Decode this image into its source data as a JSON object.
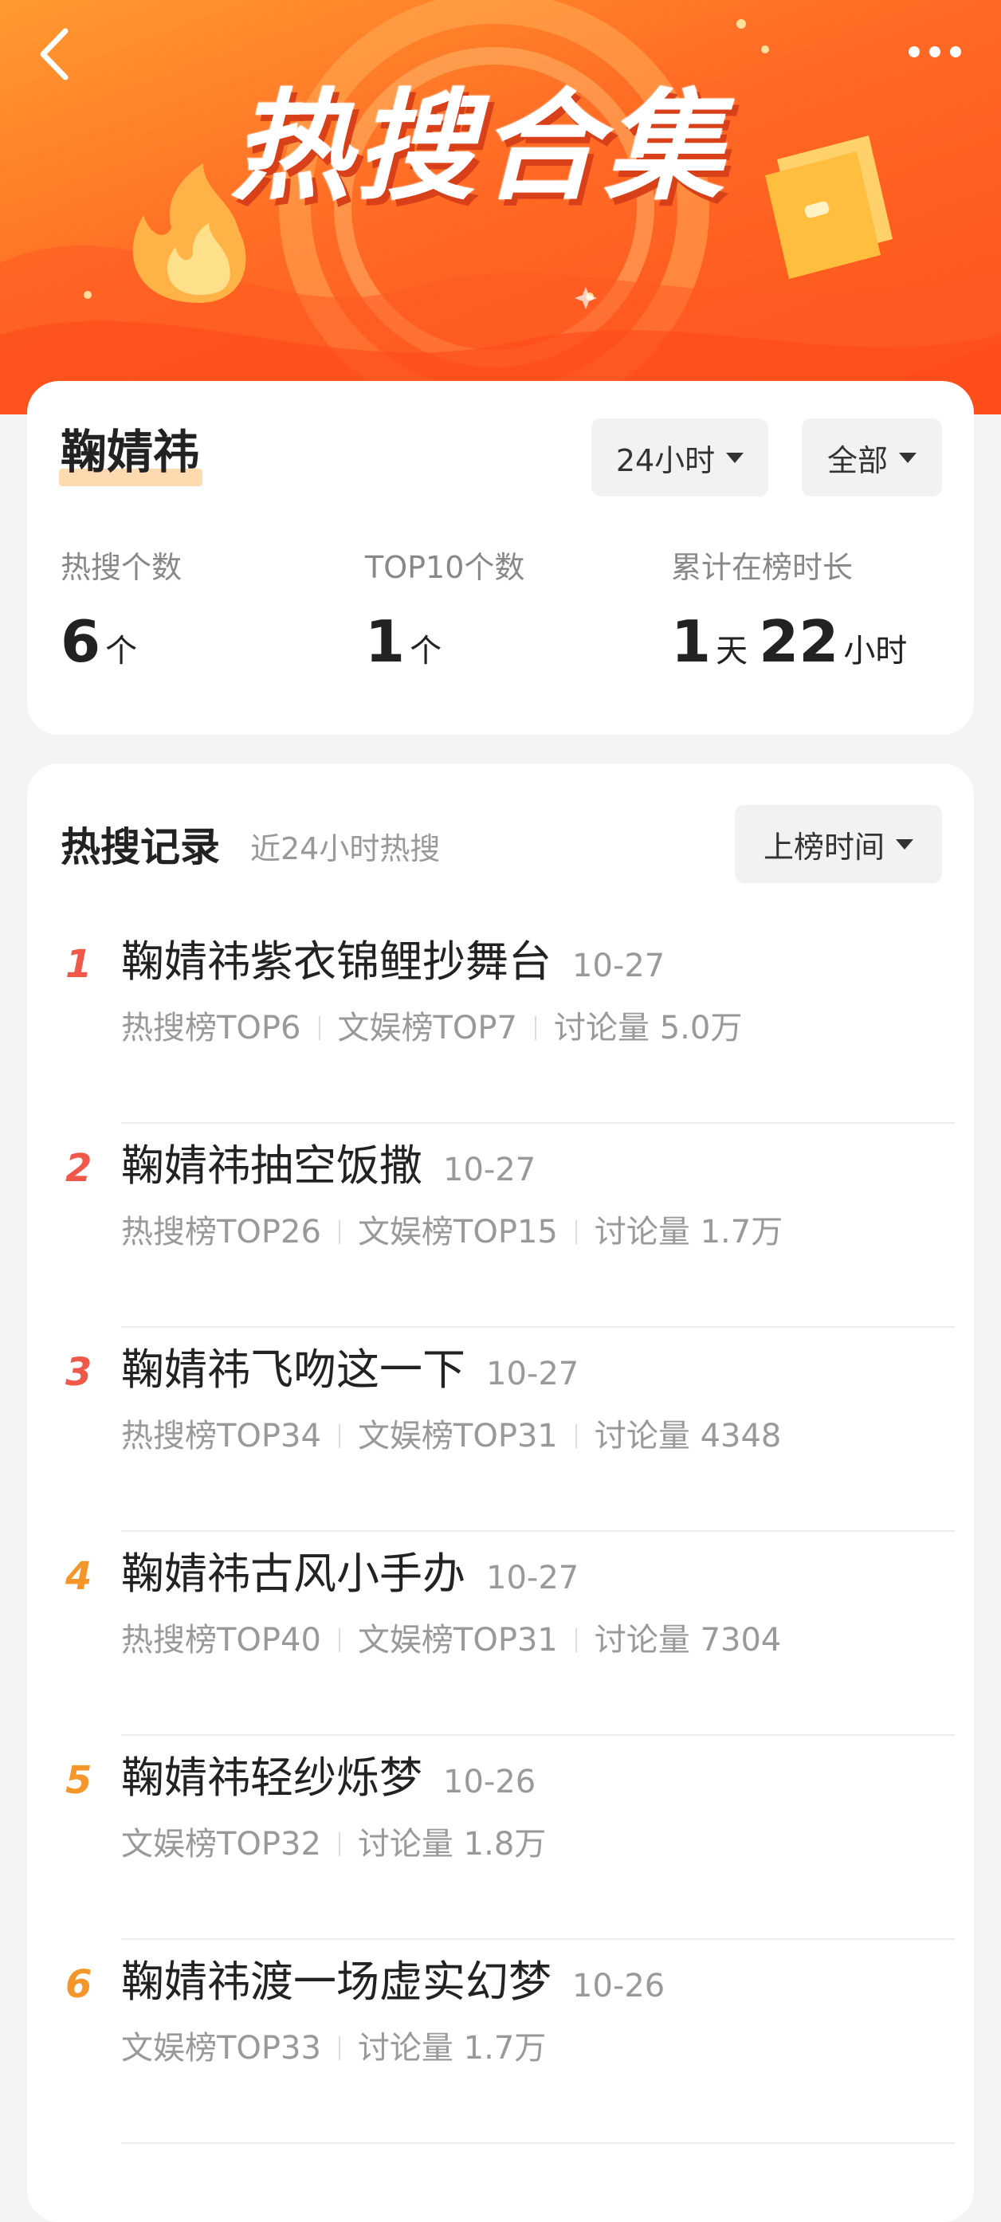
{
  "banner": {
    "title": "热搜合集"
  },
  "summary": {
    "name": "鞠婧祎",
    "time_filter": "24小时",
    "scope_filter": "全部",
    "stats": [
      {
        "label": "热搜个数",
        "value": "6",
        "unit": "个"
      },
      {
        "label": "TOP10个数",
        "value": "1",
        "unit": "个"
      },
      {
        "label": "累计在榜时长",
        "days": "1",
        "days_unit": "天",
        "hours": "22",
        "hours_unit": "小时"
      }
    ]
  },
  "records": {
    "title": "热搜记录",
    "subtitle": "近24小时热搜",
    "sort_label": "上榜时间",
    "items": [
      {
        "rank": "1",
        "title": "鞠婧祎紫衣锦鲤抄舞台",
        "date": "10-27",
        "meta": [
          "热搜榜TOP6",
          "文娱榜TOP7",
          "讨论量 5.0万"
        ]
      },
      {
        "rank": "2",
        "title": "鞠婧祎抽空饭撒",
        "date": "10-27",
        "meta": [
          "热搜榜TOP26",
          "文娱榜TOP15",
          "讨论量 1.7万"
        ]
      },
      {
        "rank": "3",
        "title": "鞠婧祎飞吻这一下",
        "date": "10-27",
        "meta": [
          "热搜榜TOP34",
          "文娱榜TOP31",
          "讨论量 4348"
        ]
      },
      {
        "rank": "4",
        "title": "鞠婧祎古风小手办",
        "date": "10-27",
        "meta": [
          "热搜榜TOP40",
          "文娱榜TOP31",
          "讨论量 7304"
        ]
      },
      {
        "rank": "5",
        "title": "鞠婧祎轻纱烁梦",
        "date": "10-26",
        "meta": [
          "文娱榜TOP32",
          "讨论量 1.8万"
        ]
      },
      {
        "rank": "6",
        "title": "鞠婧祎渡一场虚实幻梦",
        "date": "10-26",
        "meta": [
          "文娱榜TOP33",
          "讨论量 1.7万"
        ]
      }
    ]
  },
  "colors": {
    "rank_top3": "#f0584a",
    "rank_other": "#f5962a",
    "banner_start": "#ff9a2f",
    "banner_end": "#ff4f1c"
  }
}
